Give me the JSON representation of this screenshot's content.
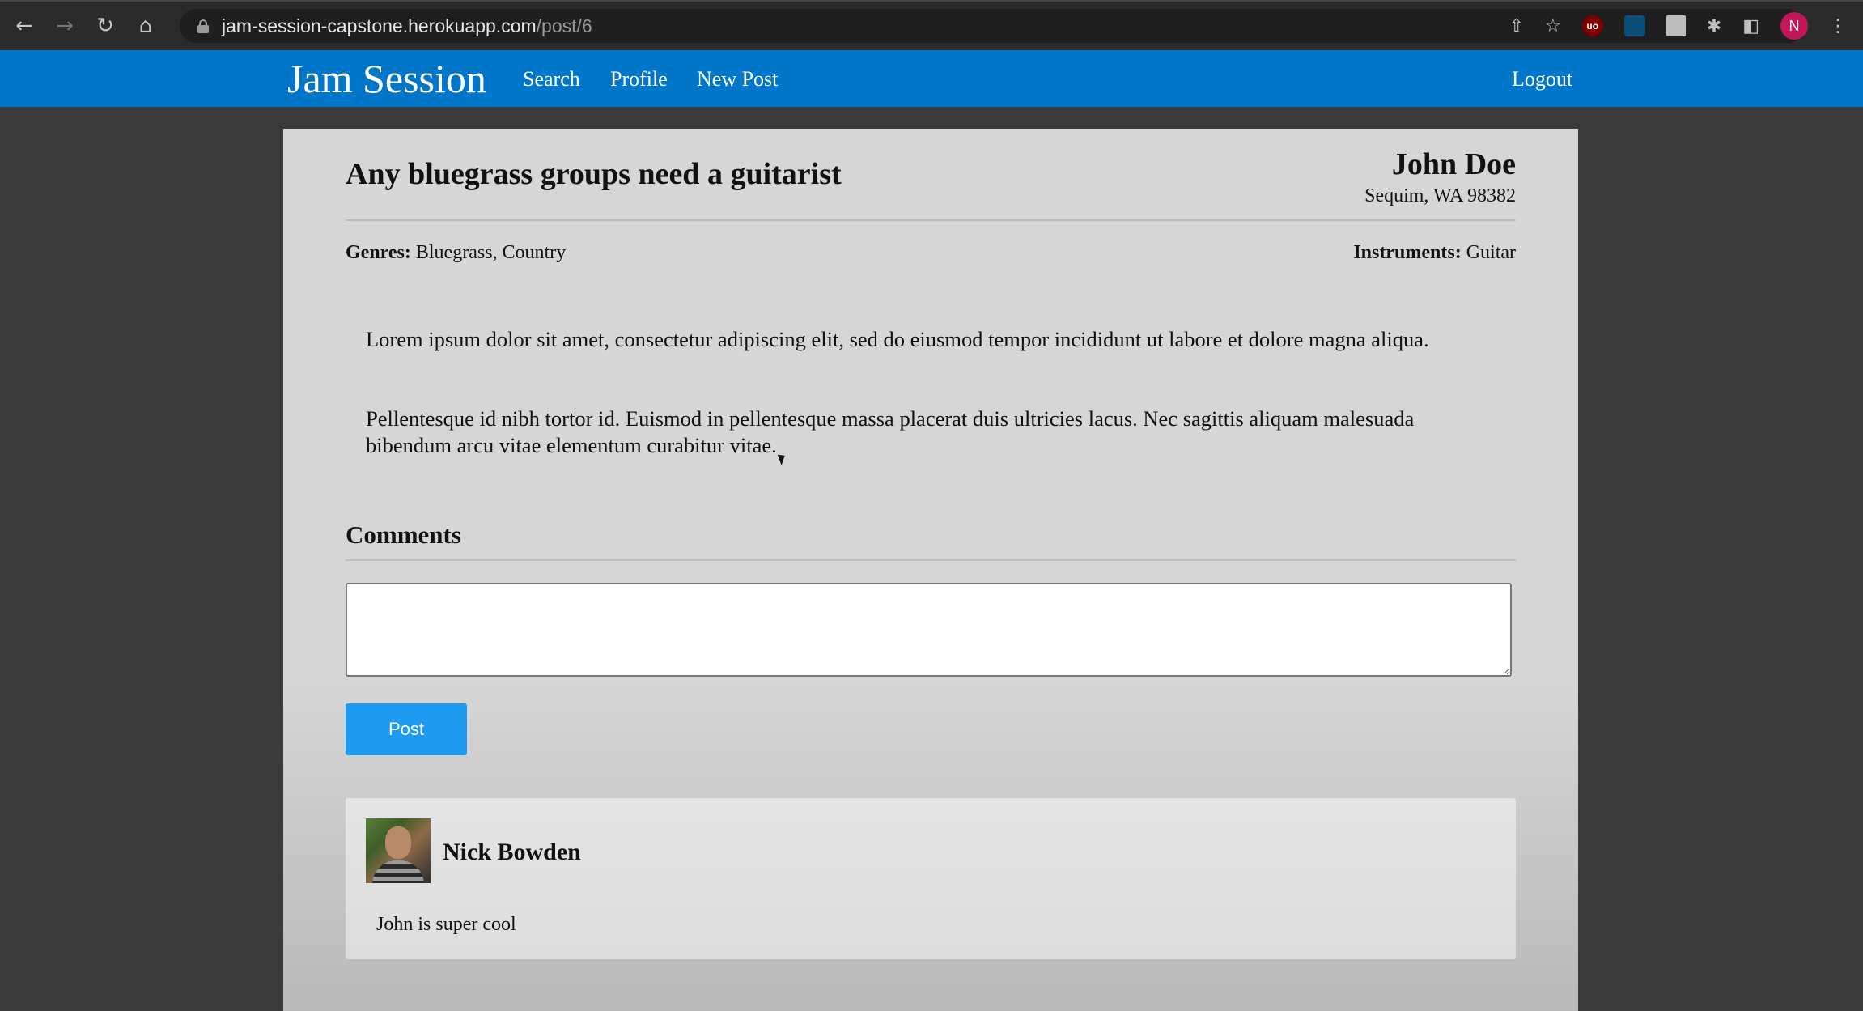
{
  "browser": {
    "url_host": "jam-session-capstone.herokuapp.com",
    "url_path": "/post/6",
    "profile_initial": "N"
  },
  "navbar": {
    "brand": "Jam Session",
    "links": [
      "Search",
      "Profile",
      "New Post"
    ],
    "logout": "Logout",
    "color": "#0277c9"
  },
  "post": {
    "title": "Any bluegrass groups need a guitarist",
    "author": "John Doe",
    "location": "Sequim, WA 98382",
    "genres_label": "Genres:",
    "genres": "Bluegrass, Country",
    "instruments_label": "Instruments:",
    "instruments": "Guitar",
    "paragraphs": [
      "Lorem ipsum dolor sit amet, consectetur adipiscing elit, sed do eiusmod tempor incididunt ut labore et dolore magna aliqua.",
      "Pellentesque id nibh tortor id. Euismod in pellentesque massa placerat duis ultricies lacus. Nec sagittis aliquam malesuada bibendum arcu vitae elementum curabitur vitae."
    ]
  },
  "comments": {
    "heading": "Comments",
    "input_value": "",
    "post_button": "Post",
    "button_color": "#1e9af0",
    "items": [
      {
        "author": "Nick Bowden",
        "text": "John is super cool"
      }
    ]
  }
}
